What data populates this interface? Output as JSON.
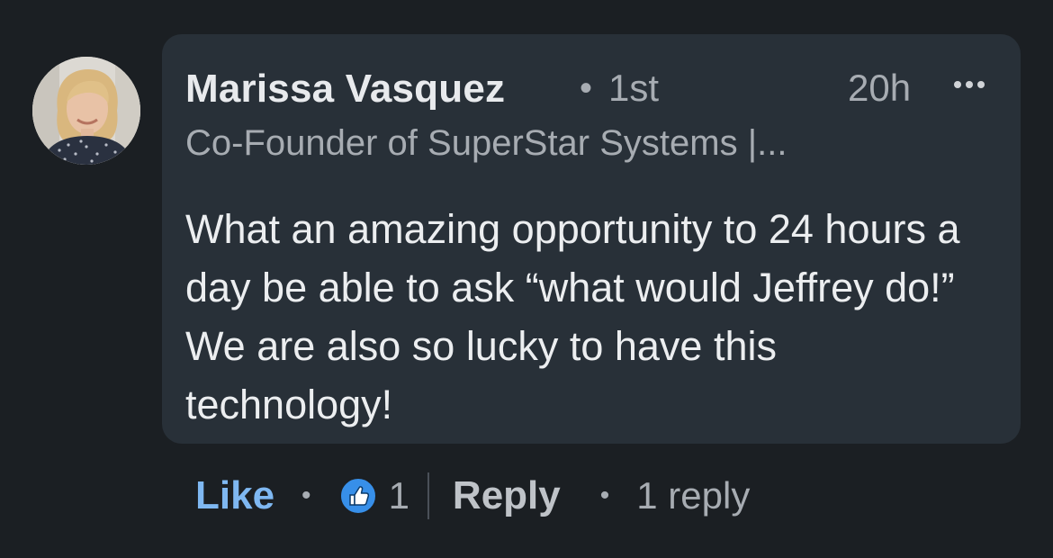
{
  "comment": {
    "author": "Marissa Vasquez",
    "separator": "•",
    "degree": "1st",
    "time": "20h",
    "headline": "Co-Founder of SuperStar Systems |...",
    "text": "What an amazing opportunity to 24 hours a day be able to ask “what would Jeffrey do!” We are also so lucky to have this technology!"
  },
  "actions": {
    "like_label": "Like",
    "dot": "•",
    "reaction_icon": "thumbs-up-icon",
    "reaction_count": "1",
    "reply_label": "Reply",
    "replies_label": "1 reply"
  },
  "colors": {
    "background": "#1b1f23",
    "bubble": "#283038",
    "like_accent": "#7fb8f2",
    "reaction_blue": "#378fe9"
  }
}
